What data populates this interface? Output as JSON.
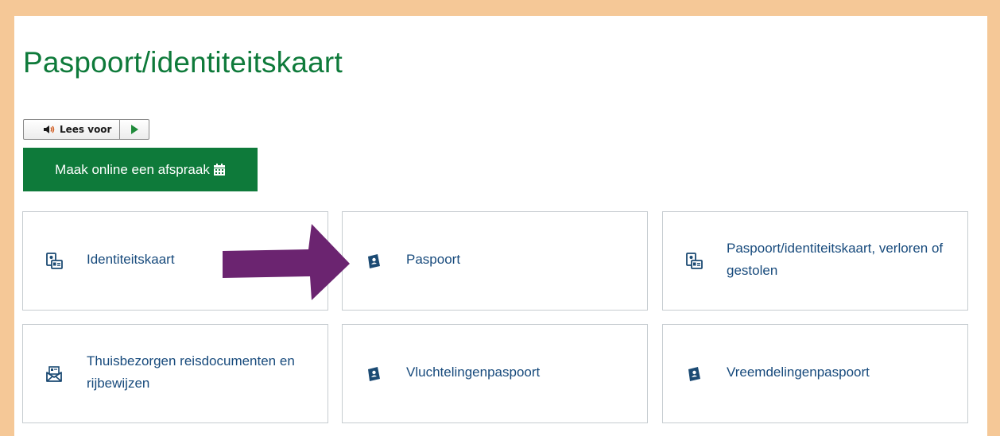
{
  "page": {
    "title": "Paspoort/identiteitskaart"
  },
  "readspeaker": {
    "listen_label": "Lees voor"
  },
  "appointment": {
    "label": "Maak online een afspraak"
  },
  "tiles": [
    {
      "label": "Identiteitskaart",
      "icon": "id-card-icon"
    },
    {
      "label": "Paspoort",
      "icon": "passport-icon"
    },
    {
      "label": "Paspoort/identiteitskaart, verloren of gestolen",
      "icon": "id-card-icon"
    },
    {
      "label": "Thuisbezorgen reisdocumenten en rijbewijzen",
      "icon": "envelope-icon"
    },
    {
      "label": "Vluchtelingenpaspoort",
      "icon": "passport-icon"
    },
    {
      "label": "Vreemdelingenpaspoort",
      "icon": "passport-icon"
    }
  ],
  "colors": {
    "page_border": "#f5c897",
    "title_green": "#0e7a3a",
    "button_green": "#0e7a3a",
    "link_blue": "#174a7c",
    "icon_navy": "#1b4a73",
    "arrow_purple": "#6b2470"
  }
}
